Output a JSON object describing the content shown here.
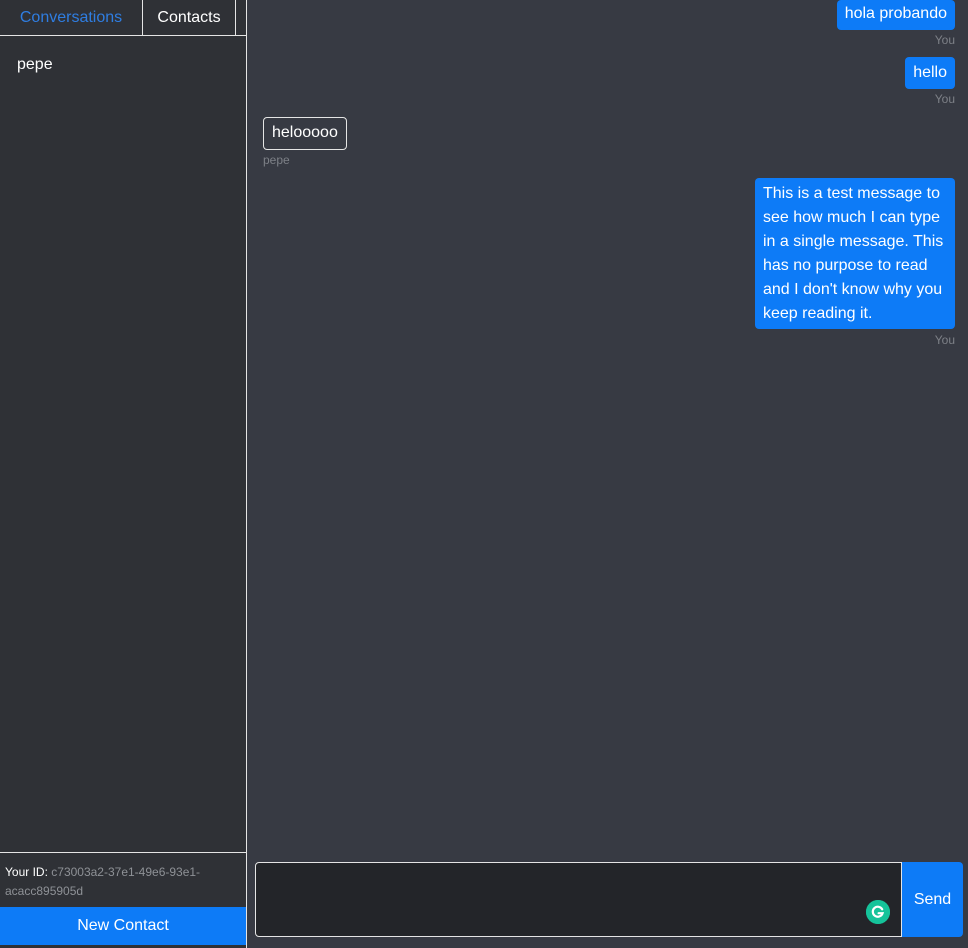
{
  "sidebar": {
    "tabs": [
      {
        "label": "Conversations",
        "active": true
      },
      {
        "label": "Contacts",
        "active": false
      }
    ],
    "conversations": [
      "pepe"
    ],
    "id_label": "Your ID:",
    "id_value": "c73003a2-37e1-49e6-93e1-acacc895905d",
    "new_contact_label": "New Contact"
  },
  "messages": [
    {
      "text": "hola probando",
      "sender": "You",
      "from_me": true
    },
    {
      "text": "hello",
      "sender": "You",
      "from_me": true
    },
    {
      "text": "helooooo",
      "sender": "pepe",
      "from_me": false
    },
    {
      "text": "This is a test message to see how much I can type in a single message. This has no purpose to read and I don't know why you keep reading it.",
      "sender": "You",
      "from_me": true
    }
  ],
  "composer": {
    "placeholder": "",
    "value": "",
    "send_label": "Send"
  },
  "colors": {
    "accent": "#0d7bf7",
    "sidebar_bg": "#2f3136",
    "chat_bg": "#373a43",
    "input_bg": "#232529",
    "grammarly": "#15c39a"
  },
  "icons": {
    "grammarly": "grammarly-icon"
  }
}
